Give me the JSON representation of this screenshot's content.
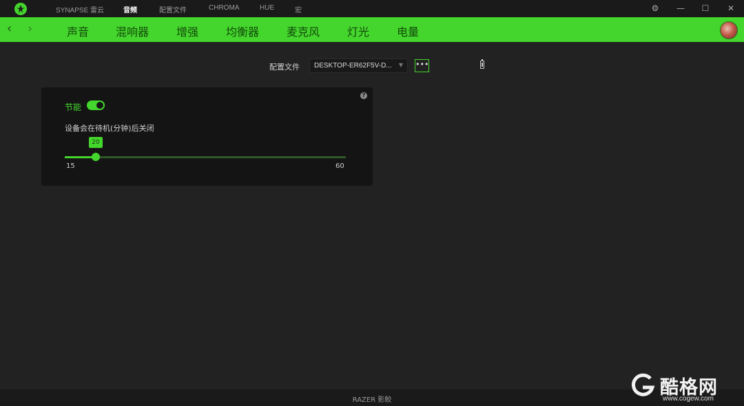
{
  "titlebar": {
    "nav": [
      {
        "label": "SYNAPSE 雷云",
        "active": false
      },
      {
        "label": "音频",
        "active": true
      },
      {
        "label": "配置文件",
        "active": false
      },
      {
        "label": "CHROMA",
        "active": false
      },
      {
        "label": "HUE",
        "active": false
      },
      {
        "label": "宏",
        "active": false
      }
    ],
    "icons": [
      "razer-logo-icon",
      "settings-gear-icon",
      "minimize-icon",
      "maximize-icon",
      "close-icon"
    ]
  },
  "subnav": {
    "tabs": [
      "声音",
      "混响器",
      "增强",
      "均衡器",
      "麦克风",
      "灯光",
      "电量"
    ],
    "active_tab": "电量",
    "accent": "#44d62c"
  },
  "profile": {
    "label": "配置文件",
    "selected": "DESKTOP-ER62F5V-D...",
    "more_label": "•••"
  },
  "power_panel": {
    "power_saving_label": "节能",
    "power_saving_enabled": true,
    "description": "设备会在待机(分钟)后关闭",
    "slider": {
      "min": 15,
      "max": 60,
      "value": 20
    },
    "min_label": "15",
    "max_label": "60",
    "value_label": "20",
    "help_label": "?"
  },
  "footer": {
    "text": "RAZER 影鲛"
  },
  "watermark": {
    "text": "酷格网",
    "url": "www.cogew.com"
  }
}
